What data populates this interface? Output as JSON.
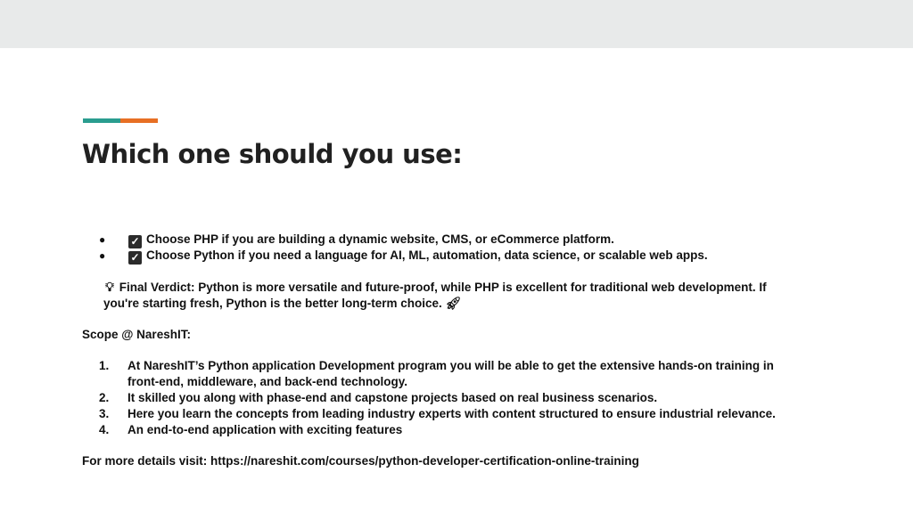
{
  "colors": {
    "top_band": "#e8eaea",
    "accent_teal": "#2a9d8f",
    "accent_orange": "#e76f24"
  },
  "title": "Which one should you use:",
  "bullets": [
    {
      "marker": "●",
      "icon": "checkbox-icon",
      "text": "Choose PHP if you are building a dynamic website, CMS, or eCommerce platform."
    },
    {
      "marker": "●",
      "icon": "checkbox-icon",
      "text": "Choose Python if you need a language for AI, ML, automation, data science, or scalable web apps."
    }
  ],
  "verdict": {
    "icon": "lightbulb-icon",
    "line1": "Final Verdict: Python is more versatile and future-proof, while PHP is excellent for traditional web development. If",
    "line2": "you're starting fresh, Python is the better long-term choice.",
    "end_icon": "rocket-icon"
  },
  "scope_heading": "Scope @ NareshIT:",
  "scope_items": [
    {
      "num": "1.",
      "line1": "At NareshIT’s Python application Development program you will be able to get the extensive hands-on training in",
      "line2": "front-end, middleware, and back-end technology."
    },
    {
      "num": "2.",
      "line1": "It skilled you along with phase-end and capstone projects based on real business scenarios."
    },
    {
      "num": "3.",
      "line1": "Here you learn the concepts from leading industry experts with content structured to ensure industrial relevance."
    },
    {
      "num": "4.",
      "line1": "An end-to-end application with exciting features"
    }
  ],
  "footer": "For more details visit: https://nareshit.com/courses/python-developer-certification-online-training"
}
